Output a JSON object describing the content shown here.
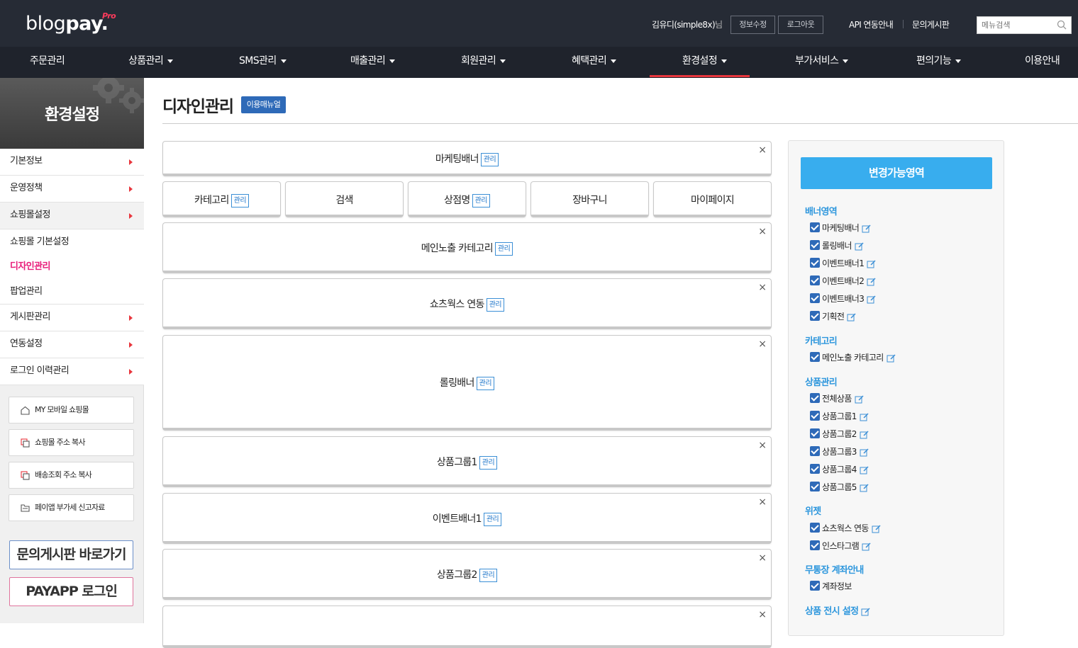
{
  "header": {
    "logo_main": "blog",
    "logo_bold": "pay.",
    "logo_pro": "Pro",
    "user_name": "김유디(simple8x)",
    "user_suffix": "님",
    "edit_info": "정보수정",
    "logout": "로그아웃",
    "api_link": "API 연동안내",
    "board_link": "문의게시판",
    "search_placeholder": "메뉴검색"
  },
  "nav": [
    {
      "label": "주문관리",
      "caret": false
    },
    {
      "label": "상품관리",
      "caret": true
    },
    {
      "label": "SMS관리",
      "caret": true
    },
    {
      "label": "매출관리",
      "caret": true
    },
    {
      "label": "회원관리",
      "caret": true
    },
    {
      "label": "혜택관리",
      "caret": true
    },
    {
      "label": "환경설정",
      "caret": true
    },
    {
      "label": "부가서비스",
      "caret": true
    },
    {
      "label": "편의기능",
      "caret": true
    },
    {
      "label": "이용안내",
      "caret": false
    }
  ],
  "sidebar": {
    "title": "환경설정",
    "items": [
      {
        "label": "기본정보"
      },
      {
        "label": "운영정책"
      },
      {
        "label": "쇼핑몰설정"
      },
      {
        "label": "게시판관리"
      },
      {
        "label": "연동설정"
      },
      {
        "label": "로그인 이력관리"
      }
    ],
    "subitems": [
      {
        "label": "쇼핑몰 기본설정"
      },
      {
        "label": "디자인관리"
      },
      {
        "label": "팝업관리"
      }
    ],
    "tools": [
      {
        "label": "MY 모바일 쇼핑몰",
        "icon": "home-icon"
      },
      {
        "label": "쇼핑몰 주소 복사",
        "icon": "copy-icon"
      },
      {
        "label": "배송조회 주소 복사",
        "icon": "copy-icon"
      },
      {
        "label": "페이앱 부가세 신고자료",
        "icon": "folder-icon"
      }
    ],
    "board_button": "문의게시판 바로가기",
    "payapp_button": "PAYAPP 로그인"
  },
  "main": {
    "title": "디자인관리",
    "manual_button": "이용매뉴얼",
    "manage_label": "관리",
    "close_label": "×",
    "blocks": [
      {
        "label": "마케팅배너",
        "manage": true
      },
      {
        "label": "메인노출 카테고리",
        "manage": true
      },
      {
        "label": "쇼츠웍스 연동",
        "manage": true
      },
      {
        "label": "롤링배너",
        "manage": true
      },
      {
        "label": "상품그룹1",
        "manage": true
      },
      {
        "label": "이벤트배너1",
        "manage": true
      },
      {
        "label": "상품그룹2",
        "manage": true
      }
    ],
    "tabs": [
      {
        "label": "카테고리",
        "manage": true
      },
      {
        "label": "검색",
        "manage": false
      },
      {
        "label": "상점명",
        "manage": true
      },
      {
        "label": "장바구니",
        "manage": false
      },
      {
        "label": "마이페이지",
        "manage": false
      }
    ]
  },
  "panel": {
    "title": "변경가능영역",
    "groups": [
      {
        "title": "배너영역",
        "options": [
          "마케팅배너",
          "롤링배너",
          "이벤트배너1",
          "이벤트배너2",
          "이벤트배너3",
          "기획전"
        ]
      },
      {
        "title": "카테고리",
        "options": [
          "메인노출 카테고리"
        ]
      },
      {
        "title": "상품관리",
        "options": [
          "전체상품",
          "상품그룹1",
          "상품그룹2",
          "상품그룹3",
          "상품그룹4",
          "상품그룹5"
        ]
      },
      {
        "title": "위젯",
        "options": [
          "쇼츠웍스 연동",
          "인스타그램"
        ]
      },
      {
        "title": "무통장 계좌안내",
        "options": [
          "계좌정보"
        ]
      },
      {
        "title": "상품 전시 설정",
        "options": []
      }
    ]
  },
  "colors": {
    "topbar": "#262b35",
    "navbar": "#1f232c",
    "nav_active": "#e8363d",
    "accent_blue": "#38adee",
    "manual_blue": "#2e6ab8",
    "current_pink": "#e81d7a"
  }
}
